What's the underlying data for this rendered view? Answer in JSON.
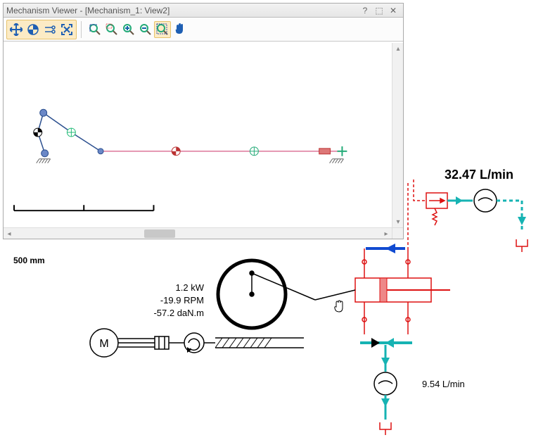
{
  "window": {
    "title": "Mechanism Viewer - [Mechanism_1: View2]",
    "help_glyph": "?",
    "pin_glyph": "⬚",
    "close_glyph": "✕"
  },
  "toolbar": {
    "mode_group": [
      {
        "name": "move-mode",
        "glyph_color": "#1e5fb3"
      },
      {
        "name": "mass-center-mode",
        "glyph_color": "#1e5fb3"
      },
      {
        "name": "velocity-mode",
        "glyph_color": "#1e5fb3"
      },
      {
        "name": "fit-mode",
        "glyph_color": "#1e5fb3"
      }
    ],
    "view_group": [
      {
        "name": "zoom-to-fit"
      },
      {
        "name": "zoom-window"
      },
      {
        "name": "zoom-in"
      },
      {
        "name": "zoom-out"
      },
      {
        "name": "zoom-region"
      },
      {
        "name": "pan"
      }
    ]
  },
  "scale": {
    "label": "500 mm"
  },
  "measurements": {
    "flow_top": "32.47 L/min",
    "flow_bottom": "9.54 L/min",
    "power": "1.2 kW",
    "rpm": "-19.9 RPM",
    "torque": "-57.2 daN.m"
  }
}
